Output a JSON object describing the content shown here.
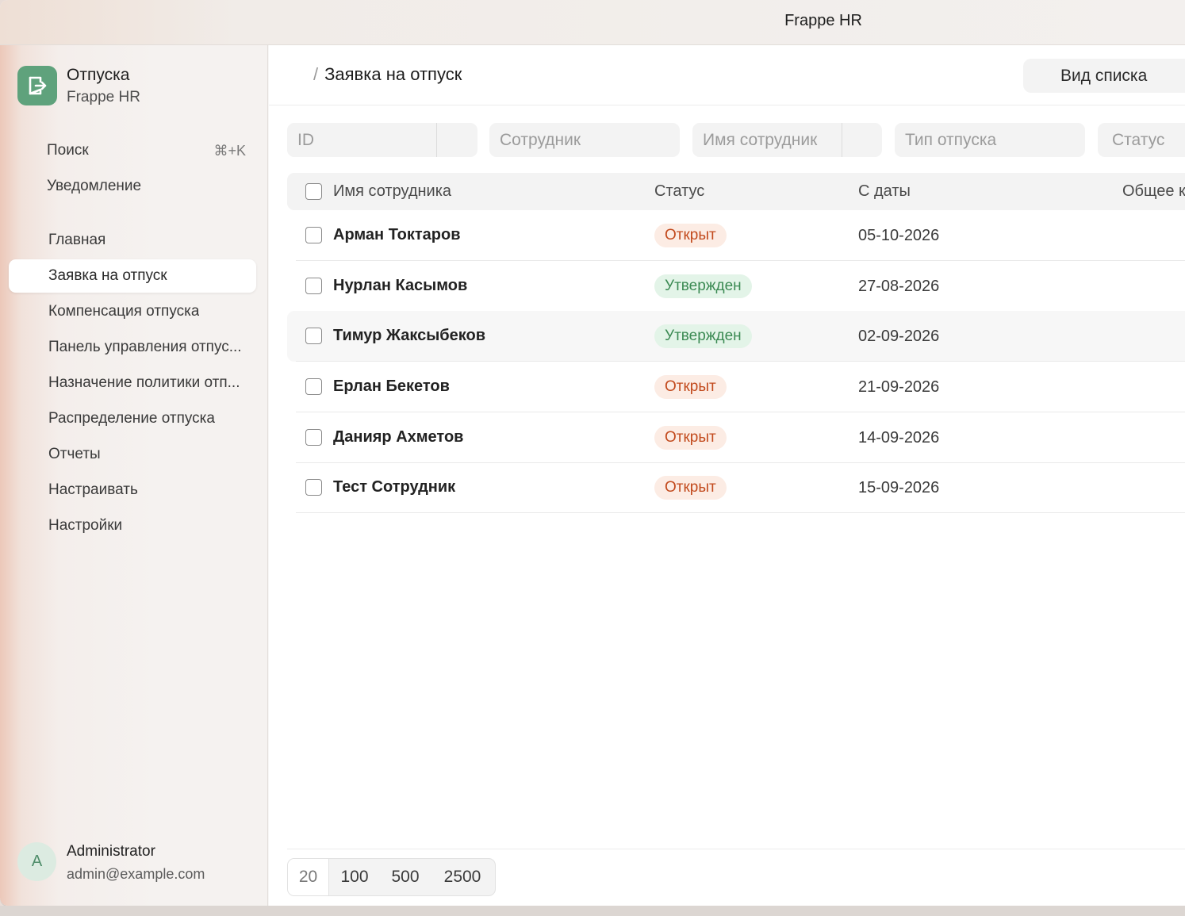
{
  "window": {
    "title": "Frappe HR"
  },
  "app": {
    "name": "Отпуска",
    "subtitle": "Frappe HR"
  },
  "sidebar": {
    "search": {
      "label": "Поиск",
      "shortcut": "⌘+K"
    },
    "notifications": "Уведомление",
    "items": [
      {
        "label": "Главная"
      },
      {
        "label": "Заявка на отпуск",
        "active": true
      },
      {
        "label": "Компенсация отпуска"
      },
      {
        "label": "Панель управления отпус..."
      },
      {
        "label": "Назначение политики отп..."
      },
      {
        "label": "Распределение отпуска"
      },
      {
        "label": "Отчеты"
      },
      {
        "label": "Настраивать"
      },
      {
        "label": "Настройки"
      }
    ]
  },
  "user": {
    "avatar_letter": "A",
    "name": "Administrator",
    "email": "admin@example.com"
  },
  "header": {
    "breadcrumb_sep": "/",
    "title": "Заявка на отпуск",
    "view_button": "Вид списка"
  },
  "filters": {
    "id": "ID",
    "employee": "Сотрудник",
    "employee_name": "Имя сотрудник",
    "leave_type": "Тип отпуска",
    "status": "Статус"
  },
  "table": {
    "columns": {
      "name": "Имя сотрудника",
      "status": "Статус",
      "from_date": "С даты",
      "total": "Общее к"
    },
    "rows": [
      {
        "name": "Арман Токтаров",
        "status": "Открыт",
        "date": "05-10-2026"
      },
      {
        "name": "Нурлан Касымов",
        "status": "Утвержден",
        "date": "27-08-2026"
      },
      {
        "name": "Тимур Жаксыбеков",
        "status": "Утвержден",
        "date": "02-09-2026"
      },
      {
        "name": "Ерлан Бекетов",
        "status": "Открыт",
        "date": "21-09-2026"
      },
      {
        "name": "Данияр Ахметов",
        "status": "Открыт",
        "date": "14-09-2026"
      },
      {
        "name": "Тест Сотрудник",
        "status": "Открыт",
        "date": "15-09-2026"
      }
    ]
  },
  "pagination": {
    "sizes": [
      "20",
      "100",
      "500",
      "2500"
    ],
    "selected": "20"
  },
  "colors": {
    "accent": "#5fa27c",
    "open_text": "#c24a1d",
    "open_bg": "#fcece4",
    "approved_text": "#3b8a53",
    "approved_bg": "#e3f4e8"
  }
}
